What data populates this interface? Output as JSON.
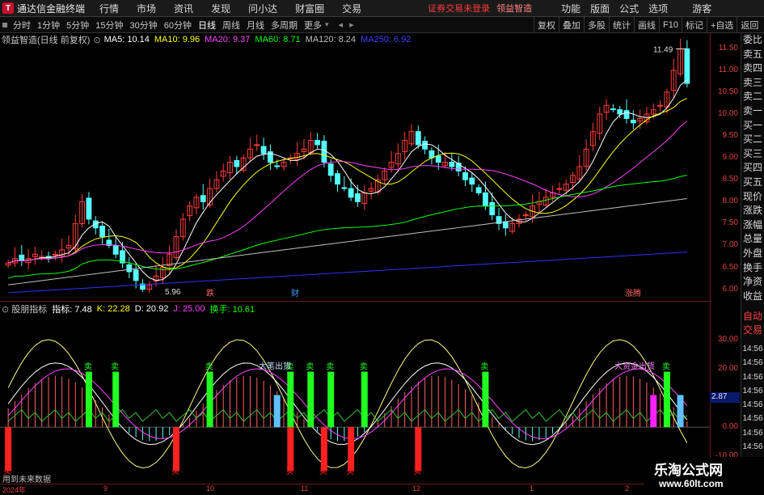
{
  "topbar": {
    "title": "通达信金融终端",
    "menu": [
      "行情",
      "市场",
      "资讯",
      "发现",
      "问小达",
      "财富圈",
      "交易"
    ],
    "notice": "证券交易未登录",
    "stock": "领益智造",
    "right_menu": [
      "功能",
      "版面",
      "公式",
      "选项"
    ],
    "user": "游客"
  },
  "periods": [
    "分时",
    "1分钟",
    "5分钟",
    "15分钟",
    "30分钟",
    "60分钟",
    "日线",
    "周线",
    "月线",
    "多周期",
    "更多"
  ],
  "active_period": "日线",
  "toolbar_buttons": [
    "复权",
    "叠加",
    "多股",
    "统计",
    "画线",
    "F10",
    "标记",
    "+自选",
    "返回"
  ],
  "legend": {
    "name": "领益智造(日线 前复权)",
    "ma5": "MA5: 10.14",
    "ma10": "MA10: 9.96",
    "ma20": "MA20: 9.37",
    "ma60": "MA60: 8.71",
    "ma120": "MA120: 8.24",
    "ma250": "MA250: 6.92"
  },
  "price_axis": [
    "11.50",
    "11.00",
    "10.50",
    "10.00",
    "9.50",
    "9.00",
    "8.50",
    "8.00",
    "7.50",
    "7.00",
    "6.50",
    "6.00"
  ],
  "high_label": "11.49",
  "low_label": "5.96",
  "chart_notes": [
    "跌",
    "财",
    "涨腾"
  ],
  "sidebar": [
    "委比",
    "卖五",
    "卖四",
    "卖三",
    "卖二",
    "卖一",
    "买一",
    "买二",
    "买三",
    "买四",
    "买五",
    "现价",
    "涨跌",
    "涨幅",
    "总量",
    "外盘",
    "换手",
    "净资",
    "收益"
  ],
  "sidebar2": [
    "自动",
    "交易"
  ],
  "indicator_legend": {
    "name": "股朋指标",
    "ind": "指标: 7.48",
    "k": "K: 22.28",
    "d": "D: 20.92",
    "j": "J: 25.00",
    "hs": "换手: 10.61"
  },
  "ind_axis": [
    "30.00",
    "20.00",
    "10.00",
    "0.00",
    "-10.00"
  ],
  "ind_value": "2.87",
  "ind_labels": [
    "大笔出货",
    "大资金出货",
    "卖",
    "买"
  ],
  "future_note": "用到未来数据",
  "time_labels": [
    "2024年",
    "9",
    "10",
    "11",
    "12",
    "1",
    "2"
  ],
  "time_col": [
    "14:56",
    "14:56",
    "14:56",
    "14:56",
    "14:56",
    "14:56",
    "14:56",
    "14:56",
    "14:56",
    "14:56"
  ],
  "watermark": {
    "line1": "乐淘公式网",
    "line2": "www.60lt.com"
  },
  "colors": {
    "up": "#ff3b3b",
    "down": "#54ffff",
    "ma5": "#ffffff",
    "ma10": "#ffff00",
    "ma20": "#ff40ff",
    "ma60": "#00ff00",
    "ma120": "#c0c0c0",
    "ma250": "#3030ff"
  },
  "chart_data": {
    "type": "line",
    "title": "领益智造(日线 前复权)",
    "ylim": [
      5.9,
      11.7
    ],
    "candles_count": 110,
    "close_path": [
      6.6,
      6.7,
      6.65,
      6.7,
      6.8,
      6.75,
      6.7,
      6.8,
      6.9,
      7.0,
      7.5,
      8.0,
      7.6,
      7.4,
      7.2,
      7.0,
      6.8,
      6.6,
      6.4,
      6.2,
      6.0,
      6.1,
      6.3,
      6.5,
      6.8,
      7.2,
      7.6,
      7.9,
      8.1,
      8.0,
      8.3,
      8.5,
      8.7,
      8.9,
      8.8,
      9.0,
      9.2,
      9.3,
      9.1,
      8.9,
      8.8,
      8.9,
      9.0,
      9.1,
      9.2,
      9.4,
      9.3,
      8.9,
      8.6,
      8.4,
      8.3,
      8.1,
      8.0,
      8.2,
      8.3,
      8.5,
      8.7,
      8.9,
      9.1,
      9.4,
      9.6,
      9.3,
      9.2,
      9.0,
      8.9,
      8.9,
      8.8,
      8.7,
      8.5,
      8.4,
      8.2,
      7.9,
      7.7,
      7.5,
      7.4,
      7.5,
      7.6,
      7.7,
      7.9,
      8.0,
      8.1,
      8.2,
      8.3,
      8.4,
      8.6,
      8.8,
      9.2,
      9.6,
      10.0,
      10.2,
      10.1,
      10.0,
      9.9,
      9.8,
      9.9,
      10.0,
      10.1,
      10.2,
      10.5,
      11.0,
      11.49,
      10.7
    ]
  }
}
